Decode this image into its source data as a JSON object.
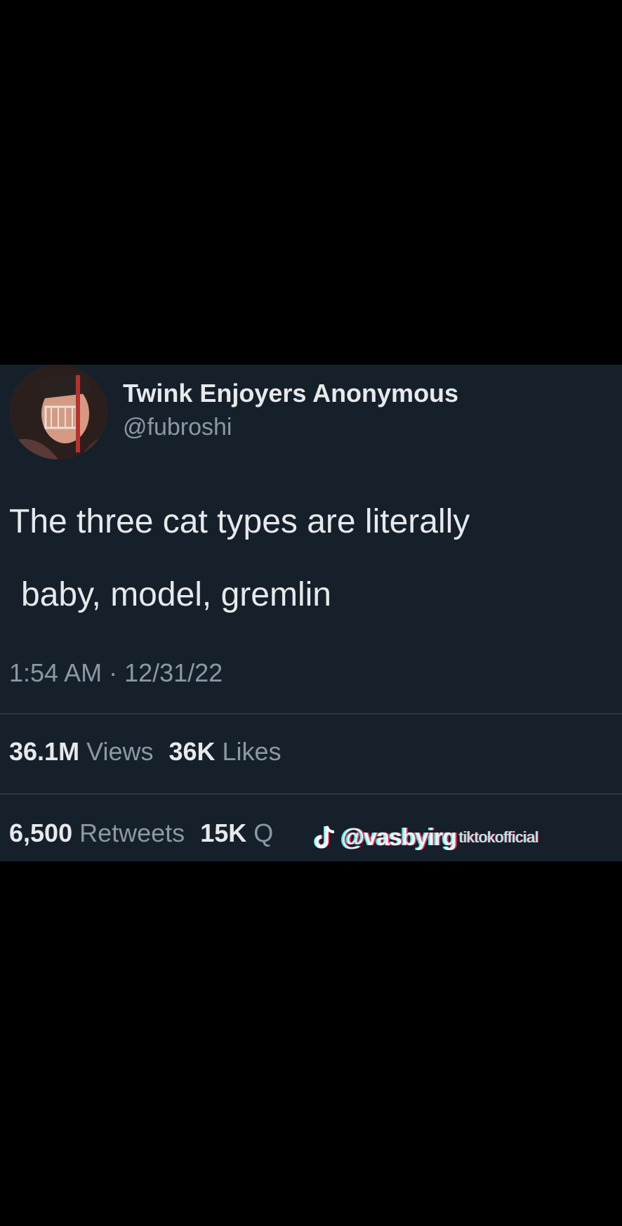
{
  "tweet": {
    "display_name": "Twink Enjoyers Anonymous",
    "handle": "@fubroshi",
    "text_line1": "The three cat types are literally",
    "text_line2": "baby, model, gremlin",
    "timestamp": "1:54 AM · 12/31/22",
    "stats": {
      "views_count": "36.1M",
      "views_label": "Views",
      "likes_count": "36K",
      "likes_label": "Likes",
      "retweets_count": "6,500",
      "retweets_label": "Retweets",
      "quotes_count": "15K",
      "quotes_label": "Q"
    }
  },
  "watermark": {
    "icon": "tiktok-icon",
    "user": "@vasbyirg",
    "sub": "tiktokofficial"
  },
  "colors": {
    "page_background": "#000000",
    "tweet_background": "#15202b",
    "primary_text": "#e7e9ea",
    "secondary_text": "#8b98a5",
    "divider": "#2a3640"
  }
}
